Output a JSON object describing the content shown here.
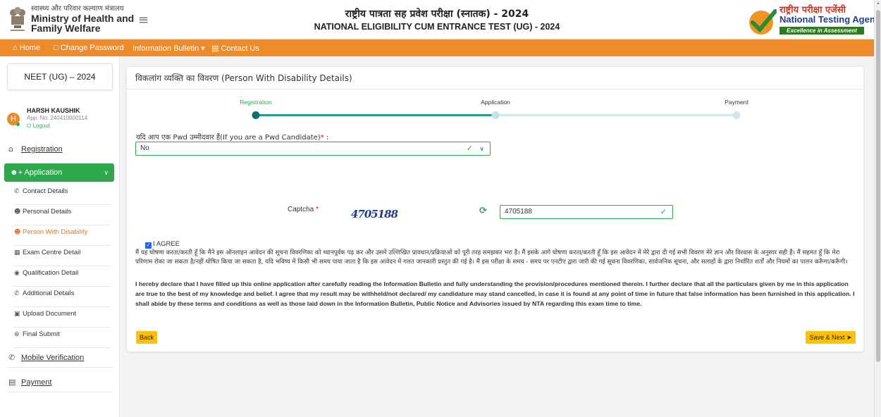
{
  "header": {
    "ministry_hi": "स्वास्थ्य और परिवार कल्याण मंत्रालय",
    "ministry_en_line1": "Ministry of Health and",
    "ministry_en_line2": "Family Welfare",
    "menu_icon": "hamburger-icon",
    "title_hi": "राष्ट्रीय पात्रता सह प्रवेश परीक्षा (स्नातक) - 2024",
    "title_en": "NATIONAL ELIGIBILITY CUM ENTRANCE TEST (UG) - 2024",
    "nta_hi": "राष्ट्रीय परीक्षा एजेंसी",
    "nta_en": "National Testing Agency",
    "nta_tagline": "Excellence in Assessment"
  },
  "nav": {
    "home": "Home",
    "change_password": "Change Password",
    "information_bulletin": "Information Bulletin",
    "contact_us": "Contact Us"
  },
  "sidebar": {
    "exam": "NEET (UG) – 2024",
    "user_name": "HARSH KAUSHIK",
    "app_no": "App. No: 240410000114",
    "avatar_initial": "H",
    "logout": "Logout",
    "registration": "Registration",
    "application": "Application",
    "items": [
      {
        "label": "Contact Details",
        "icon": "phone-icon"
      },
      {
        "label": "Personal Details",
        "icon": "person-icon"
      },
      {
        "label": "Person With Disability",
        "icon": "person-icon",
        "active": true
      },
      {
        "label": "Exam Centre Detail",
        "icon": "building-icon"
      },
      {
        "label": "Qualification Detail",
        "icon": "award-icon"
      },
      {
        "label": "Additional Details",
        "icon": "phone-icon"
      },
      {
        "label": "Upload Document",
        "icon": "upload-icon"
      },
      {
        "label": "Final Submit",
        "icon": "check-circle-icon"
      }
    ],
    "mobile_verification": "Mobile Verification",
    "payment": "Payment"
  },
  "main": {
    "card_title": "विकलांग व्यक्ति का विवरण (Person With Disability Details)",
    "steps": [
      {
        "label": "Registration",
        "status": "done"
      },
      {
        "label": "Application",
        "status": "current"
      },
      {
        "label": "Payment",
        "status": "pending"
      }
    ],
    "pwd_label": "यदि आप एक Pwd उम्मीदवार हैं(If you are a Pwd Candidate)",
    "pwd_value": "No",
    "captcha_label": "Captcha",
    "captcha_image_text": "4705188",
    "captcha_value": "4705188",
    "agree_label": "I AGREE",
    "declaration_hi": "मैं यह घोषणा करता/करती हूँ कि मैंने इस ऑनलाइन आवेदन की सूचना विवरणिका को ध्यानपूर्वक पढ़ कर और उसमें उल्लिखित प्रावधान/प्रक्रियाओं को पूरी तरह समझकर भरा है। मैं इसके आगे घोषणा करता/करती हूँ कि इस आवेदन में मेरे द्वारा दी गई सभी विवरण मेरे ज्ञान और विश्वास के अनुसार सही हैं। मैं सहमत हूँ कि मेरा परिणाम रोका जा सकता है/नहीं घोषित किया जा सकता है, यदि भविष्य में किसी भी समय पाया जाता है कि इस आवेदन में गलत जानकारी प्रस्तुत की गई है। मैं इस परीक्षा के समय - समय पर एनटीए द्वारा जारी की गई सूचना विवरणिका, सार्वजनिक सूचना, और सलाहों के द्वारा निर्धारित शर्तों और नियमों का पालन करूँगा/करूँगी।",
    "declaration_en": "I hereby declare that I have filled up this online application after carefully reading the Information Bulletin and fully understanding the provision/procedures mentioned therein. I further declare that all the particulars given by me in this application are true to the best of my knowledge and belief. I agree that my result may be withheld/not declared/ my candidature may stand cancelled, in case it is found at any point of time in future that false information has been furnished in this application. I shall abide by these terms and conditions as well as those laid down in the Information Bulletin, Public Notice and Advisories issued by NTA regarding this exam time to time.",
    "back_label": "Back",
    "save_next_label": "Save & Next"
  },
  "colors": {
    "nav_orange": "#ed8b2a",
    "accent_green": "#2ea84c",
    "button_yellow": "#ffc107",
    "active_orange": "#e2732b"
  }
}
